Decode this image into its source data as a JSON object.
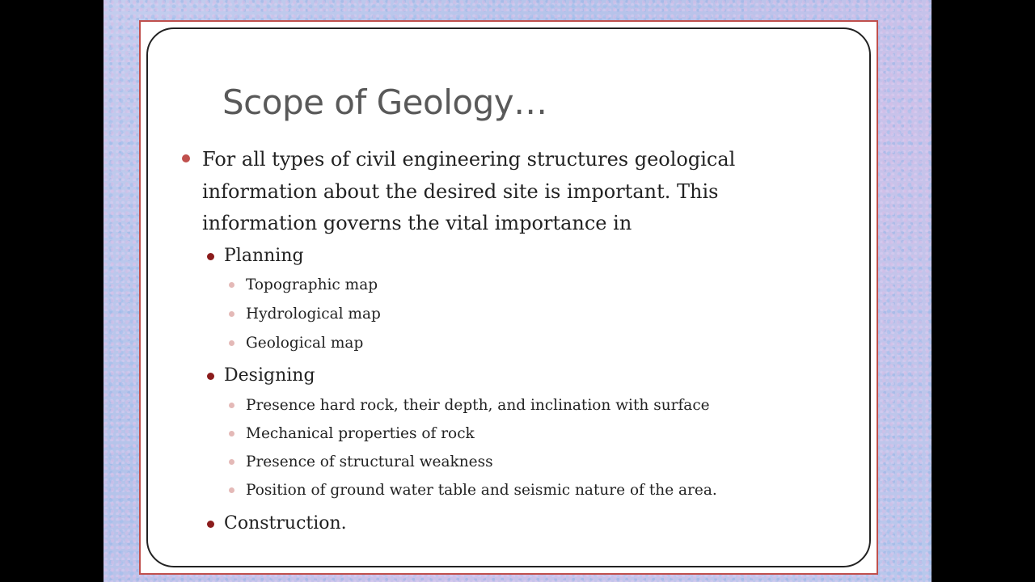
{
  "slide": {
    "title": "Scope of Geology…",
    "intro": "For all types of civil engineering structures geological information about the desired site is important. This information governs the vital importance in",
    "sections": [
      {
        "label": "Planning",
        "items": [
          "Topographic map",
          "Hydrological map",
          "Geological map"
        ]
      },
      {
        "label": "Designing",
        "items": [
          "Presence hard rock, their depth, and inclination with surface",
          "Mechanical properties of rock",
          "Presence of structural weakness",
          "Position of ground water table and seismic nature of the area."
        ]
      },
      {
        "label": "Construction.",
        "items": []
      }
    ]
  },
  "colors": {
    "accent": "#c0504d",
    "bullet_level2": "#8b1c1c",
    "bullet_level3": "#e4b9b7",
    "title_text": "#595959",
    "body_text": "#222222",
    "background": "#b9c6ea"
  }
}
